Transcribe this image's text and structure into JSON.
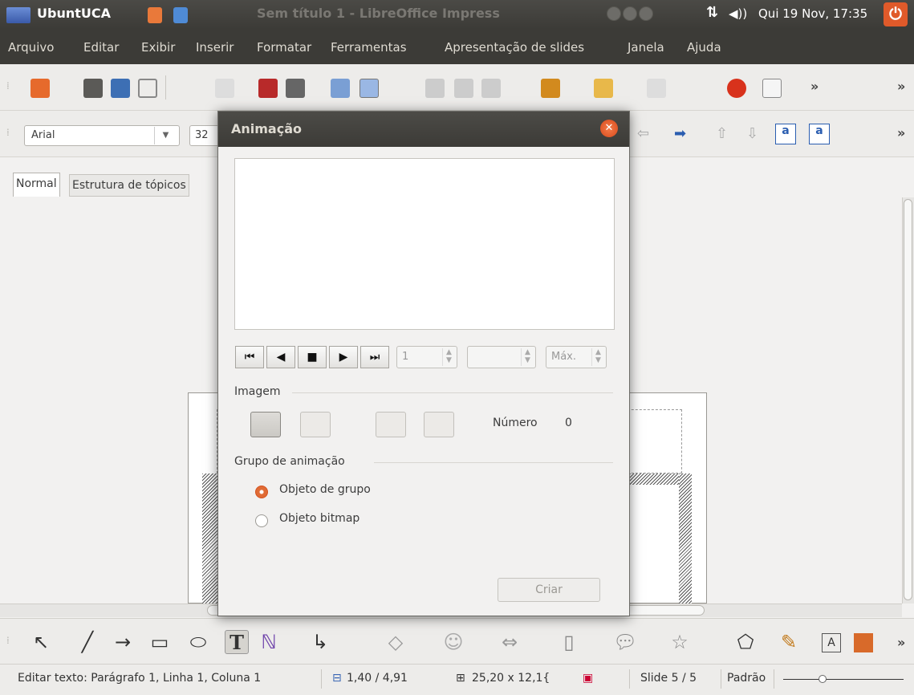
{
  "panel": {
    "app_name": "UbuntUCA",
    "window_title": "Sem título 1 - LibreOffice Impress",
    "clock": "Qui 19 Nov, 17:35",
    "net_icon": "network-icon",
    "vol_icon": "volume-icon"
  },
  "menu": [
    "Arquivo",
    "Editar",
    "Exibir",
    "Inserir",
    "Formatar",
    "Ferramentas",
    "Apresentação de slides",
    "Janela",
    "Ajuda"
  ],
  "toolbar": {
    "font_name": "Arial",
    "font_size": "32",
    "overflow": "»"
  },
  "tabs": {
    "normal": "Normal",
    "outline": "Estrutura de tópicos"
  },
  "dialog": {
    "title": "Animação",
    "frame_spin": "1",
    "max_spin": "Máx.",
    "section_image": "Imagem",
    "numero_label": "Número",
    "numero_value": "0",
    "section_group": "Grupo de animação",
    "radio_group": "Objeto de grupo",
    "radio_bitmap": "Objeto bitmap",
    "create_button": "Criar",
    "selected_option": "Objeto de grupo"
  },
  "status": {
    "edit_text": "Editar texto: Parágrafo 1, Linha 1, Coluna 1",
    "position": "1,40 / 4,91",
    "size": "25,20 x 12,1{",
    "slide": "Slide 5 / 5",
    "layout": "Padrão"
  },
  "colors": {
    "accent": "#e05a2a",
    "panel": "#3c3b37"
  }
}
